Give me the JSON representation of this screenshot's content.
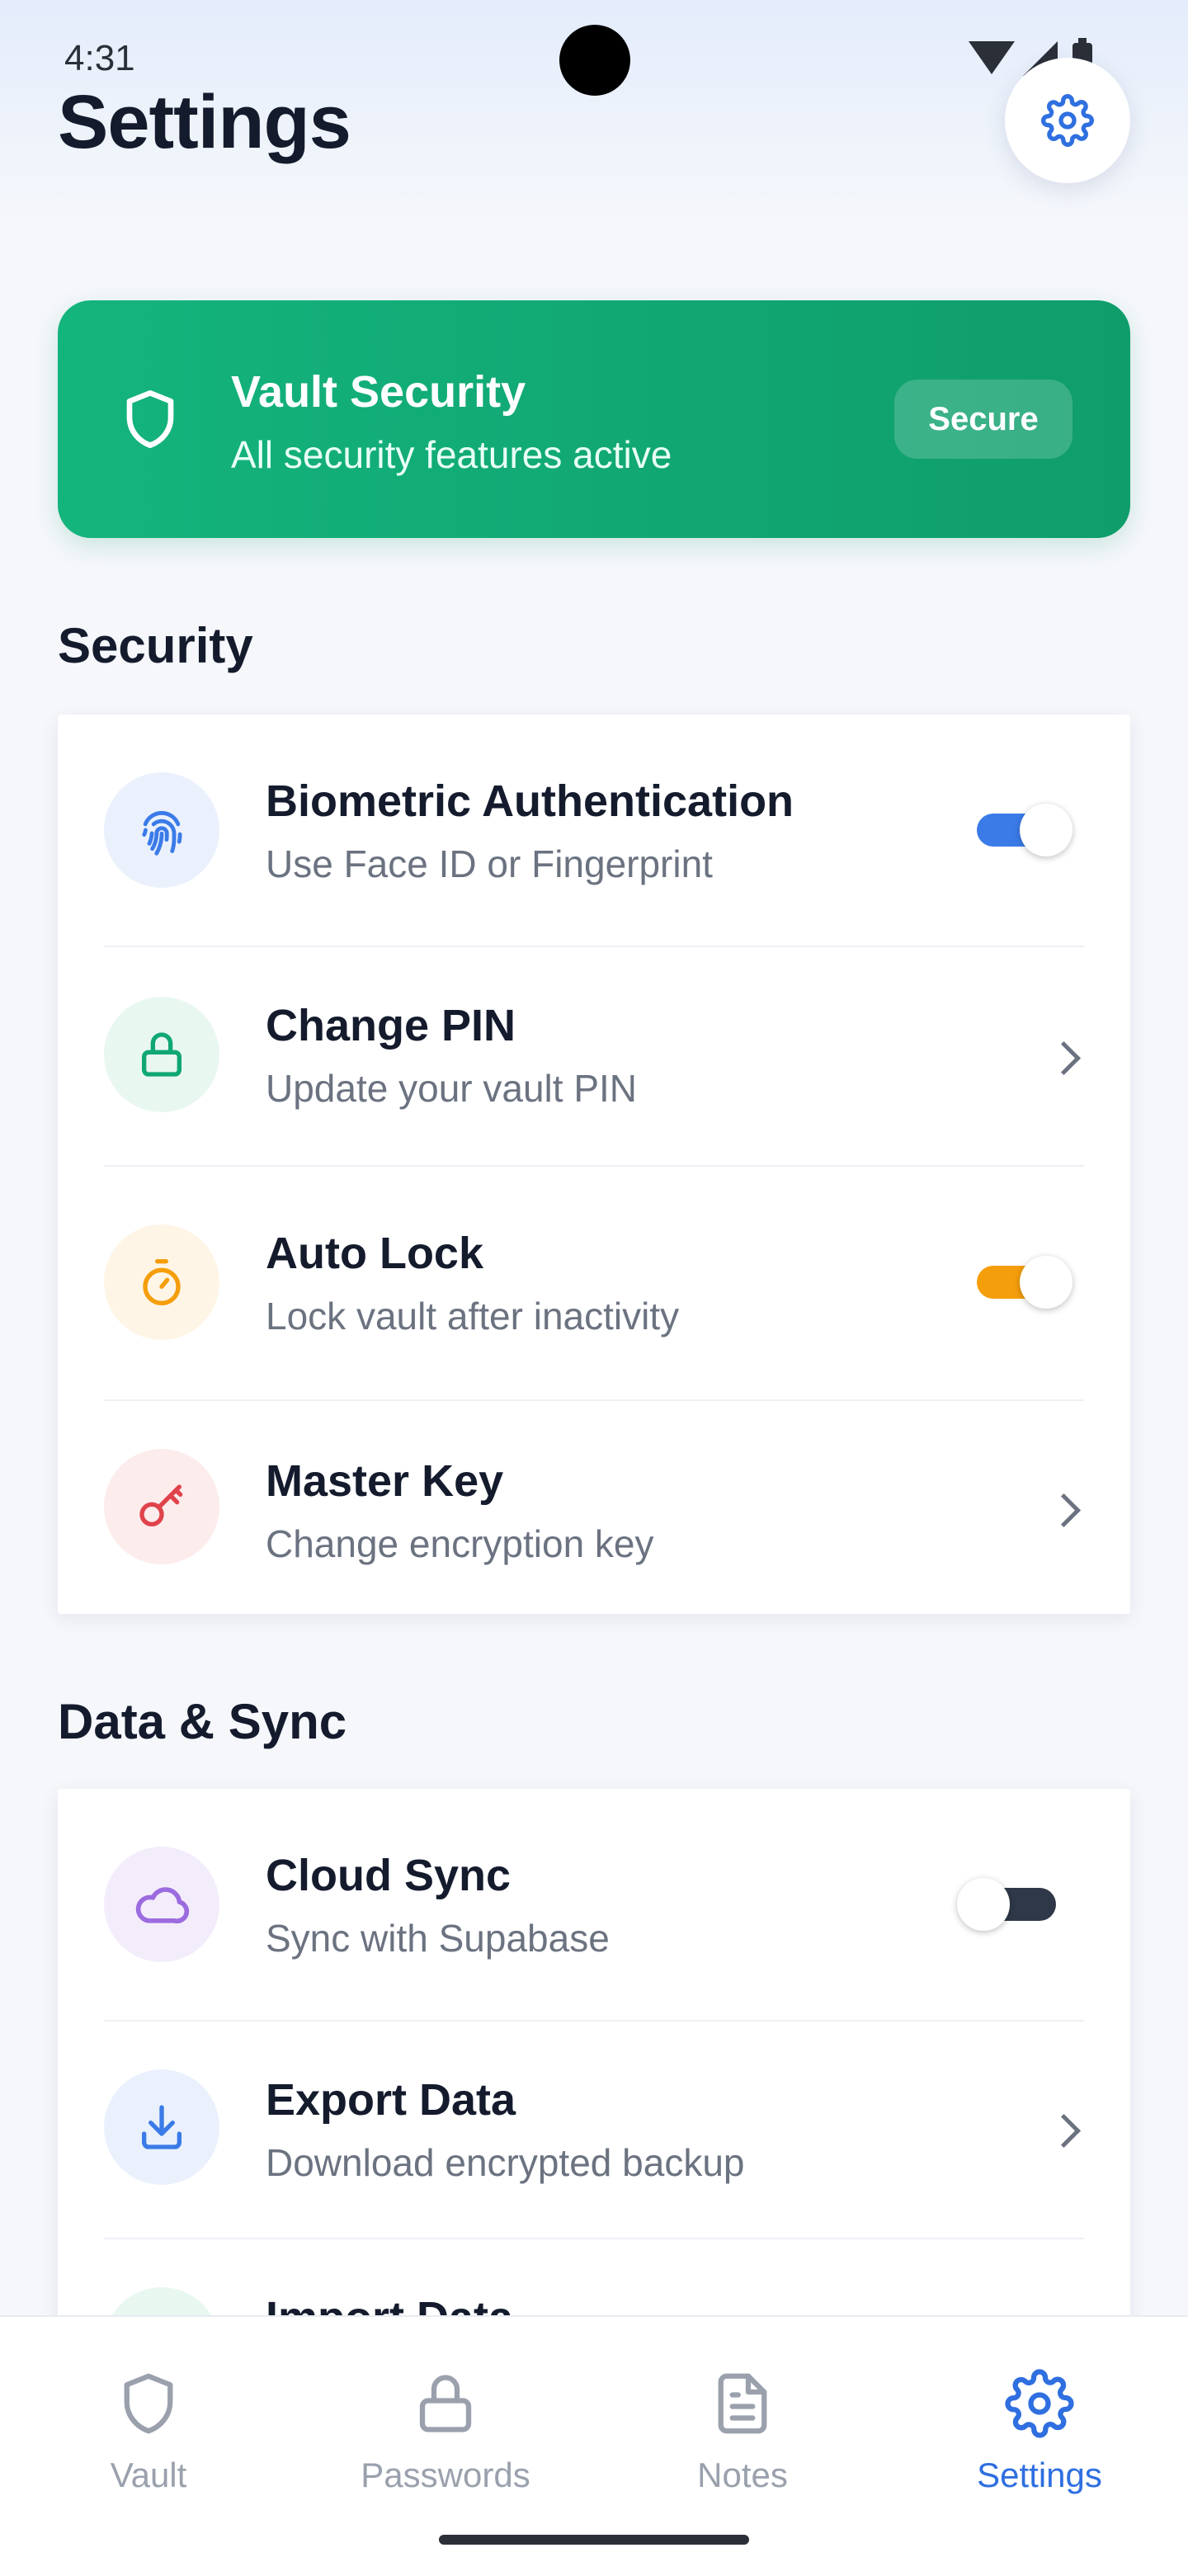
{
  "status_bar": {
    "time": "4:31"
  },
  "header": {
    "title": "Settings",
    "action_icon": "gear-icon"
  },
  "security_banner": {
    "title": "Vault Security",
    "subtitle": "All security features active",
    "badge": "Secure",
    "icon": "shield-icon",
    "color": "#10a774"
  },
  "sections": [
    {
      "title": "Security",
      "items": [
        {
          "title": "Biometric Authentication",
          "subtitle": "Use Face ID or Fingerprint",
          "icon": "fingerprint-icon",
          "control": "toggle",
          "on": true,
          "accent": "#3b7be8"
        },
        {
          "title": "Change PIN",
          "subtitle": "Update your vault PIN",
          "icon": "lock-icon",
          "control": "chevron",
          "accent": "#10a774"
        },
        {
          "title": "Auto Lock",
          "subtitle": "Lock vault after inactivity",
          "icon": "timer-icon",
          "control": "toggle",
          "on": true,
          "accent": "#f59e0b"
        },
        {
          "title": "Master Key",
          "subtitle": "Change encryption key",
          "icon": "key-icon",
          "control": "chevron",
          "accent": "#e0434b"
        }
      ]
    },
    {
      "title": "Data & Sync",
      "items": [
        {
          "title": "Cloud Sync",
          "subtitle": "Sync with Supabase",
          "icon": "cloud-icon",
          "control": "toggle",
          "on": false,
          "accent": "#9b6bdf"
        },
        {
          "title": "Export Data",
          "subtitle": "Download encrypted backup",
          "icon": "download-icon",
          "control": "chevron",
          "accent": "#3b7be8"
        },
        {
          "title": "Import Data",
          "subtitle": "",
          "icon": "upload-icon",
          "control": "chevron",
          "accent": "#10a774"
        }
      ]
    }
  ],
  "bottom_nav": [
    {
      "label": "Vault",
      "icon": "shield-icon",
      "active": false
    },
    {
      "label": "Passwords",
      "icon": "lock-icon",
      "active": false
    },
    {
      "label": "Notes",
      "icon": "document-icon",
      "active": false
    },
    {
      "label": "Settings",
      "icon": "gear-icon",
      "active": true
    }
  ]
}
